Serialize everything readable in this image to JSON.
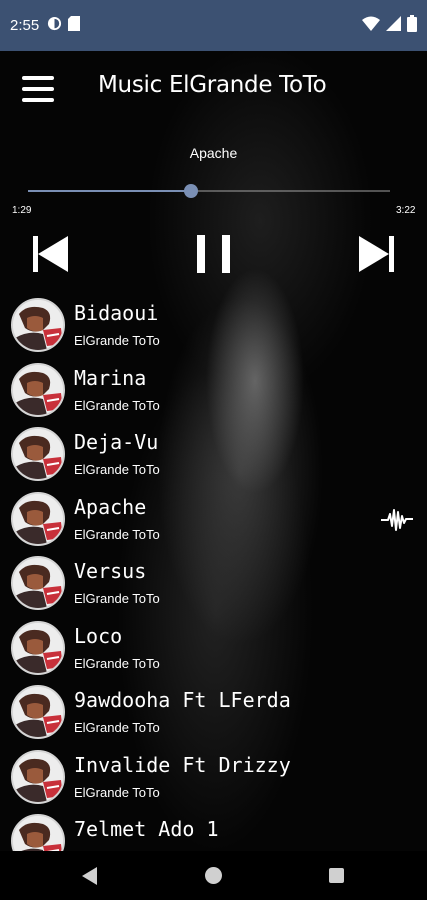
{
  "status_bar": {
    "time": "2:55",
    "left_icons": [
      "data-saver-icon",
      "sd-card-icon"
    ],
    "right_icons": [
      "wifi-icon",
      "signal-icon",
      "battery-icon"
    ]
  },
  "app_bar": {
    "title": "Music ElGrande ToTo",
    "menu_icon": "hamburger-menu-icon"
  },
  "player": {
    "now_playing_title": "Apache",
    "current_time": "1:29",
    "total_time": "3:22",
    "progress": 0.45,
    "controls": [
      "skip-previous-icon",
      "pause-icon",
      "skip-next-icon"
    ]
  },
  "songs": [
    {
      "title": "Bidaoui",
      "artist": "ElGrande ToTo",
      "playing": false
    },
    {
      "title": "Marina",
      "artist": "ElGrande ToTo",
      "playing": false
    },
    {
      "title": "Deja-Vu",
      "artist": "ElGrande ToTo",
      "playing": false
    },
    {
      "title": "Apache",
      "artist": "ElGrande ToTo",
      "playing": true
    },
    {
      "title": "Versus",
      "artist": "ElGrande ToTo",
      "playing": false
    },
    {
      "title": "Loco",
      "artist": "ElGrande ToTo",
      "playing": false
    },
    {
      "title": "9awdooha Ft LFerda",
      "artist": "ElGrande ToTo",
      "playing": false
    },
    {
      "title": "Invalide Ft Drizzy",
      "artist": "ElGrande ToTo",
      "playing": false
    },
    {
      "title": "7elmet Ado 1",
      "artist": "ElGrande ToTo",
      "playing": false
    }
  ],
  "playing_indicator_icon": "audio-wave-icon",
  "nav_bar": {
    "icons": [
      "back-icon",
      "home-icon",
      "recents-icon"
    ]
  },
  "colors": {
    "status_bar": "#3c5172",
    "accent": "#7a8fb4",
    "background": "#000000"
  }
}
